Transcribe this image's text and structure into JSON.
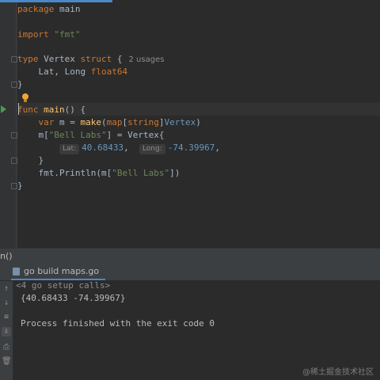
{
  "editor": {
    "lines": {
      "l1": {
        "kw": "package",
        "name": "main"
      },
      "l3": {
        "kw": "import",
        "str": "\"fmt\""
      },
      "l5": {
        "kw": "type",
        "name": "Vertex",
        "kw2": "struct",
        "brace": "{",
        "usages": "2 usages"
      },
      "l6": {
        "fields": "Lat, Long",
        "type": "float64"
      },
      "l7": {
        "text": "}"
      },
      "l9": {
        "kw": "func",
        "name": "main",
        "rest": "() {"
      },
      "l10": {
        "kw": "var",
        "mid": "m = ",
        "fn": "make",
        "open": "(",
        "map": "map",
        "lb": "[",
        "string": "string",
        "rb": "]",
        "vt": "Vertex",
        "close": ")"
      },
      "l11": {
        "pre": "m[",
        "str": "\"Bell Labs\"",
        "mid": "] = Vertex{"
      },
      "l11b": {
        "lat_hint": "Lat:",
        "lat": "40.68433",
        "comma1": ",",
        "long_hint": "Long:",
        "long": "-74.39967",
        "comma2": ","
      },
      "l12": {
        "text": "}"
      },
      "l13": {
        "pre": "fmt.Println(m[",
        "str": "\"Bell Labs\"",
        "post": "])"
      },
      "l14": {
        "text": "}"
      }
    }
  },
  "breadcrumb": "n()",
  "run_panel": {
    "tab_label": "go build maps.go",
    "collapsed_calls": "<4 go setup calls>",
    "output": "{40.68433 -74.39967}",
    "finished": "Process finished with the exit code 0"
  },
  "toolbar": {
    "up": "↑",
    "down": "↓",
    "wrap": "≡",
    "scroll_end": "⇩",
    "print": "⎙",
    "trash": "🗑"
  },
  "watermark": "@稀土掘金技术社区",
  "colors": {
    "background": "#2b2b2b",
    "keyword": "#cc7832",
    "function": "#ffc66d",
    "string": "#6a8759",
    "number": "#6897bb",
    "accent": "#4a88c7"
  }
}
